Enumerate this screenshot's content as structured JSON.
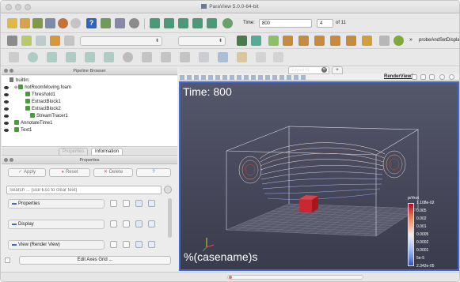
{
  "window": {
    "title": "ParaView 5.0.0-64-bit"
  },
  "toolbar": {
    "time_label": "Time:",
    "time_value": "800",
    "timestep_value": "4",
    "of_label": "of 11",
    "more_glyph": "»",
    "macro_label": "probeAndSetDisplay"
  },
  "pipeline": {
    "title": "Pipeline Browser",
    "items": [
      {
        "label": "builtin:"
      },
      {
        "label": "hotRoomMoving.foam"
      },
      {
        "label": "Threshold1"
      },
      {
        "label": "ExtractBlock1"
      },
      {
        "label": "ExtractBlock2"
      },
      {
        "label": "StreamTracer1"
      },
      {
        "label": "AnnotateTime1"
      },
      {
        "label": "Text1"
      }
    ]
  },
  "tabs": {
    "properties": "Properties",
    "information": "Information"
  },
  "properties": {
    "title": "Properties",
    "apply": "Apply",
    "reset": "Reset",
    "delete": "Delete",
    "help": "?",
    "search_placeholder": "Search ... (use Esc to clear text)",
    "sections": [
      {
        "label": "Properties"
      },
      {
        "label": "Display"
      },
      {
        "label": "View (Render View)"
      }
    ],
    "edit_axes": "Edit Axes Grid ..."
  },
  "view": {
    "layout_tab": "Layout #1",
    "add_tab": "+",
    "render_view_label": "RenderView1",
    "time_text": "Time: 800",
    "casename_text": "%(casename)s",
    "colorbar": {
      "title": "p/rhot",
      "labels": [
        "1.108e-02",
        "0.005",
        "0.002",
        "0.001",
        "0.0005",
        "0.0002",
        "0.0001",
        "5e-5",
        "2.342e-05"
      ],
      "colors": [
        "#b40426",
        "#d65244",
        "#ef8a62",
        "#f7b89c",
        "#f2f0ef",
        "#cbd8ee",
        "#9ebbf4",
        "#6a8fe0",
        "#3b4cc0"
      ]
    }
  }
}
